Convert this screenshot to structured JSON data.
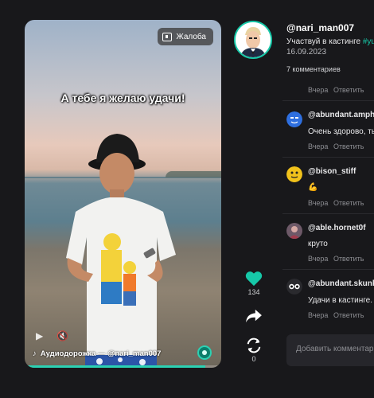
{
  "video": {
    "report_label": "Жалоба",
    "caption": "А тебе я желаю удачи!",
    "audio_track": "Аудиодорожка — @nari_man007",
    "progress_fraction": 0.92
  },
  "actions": {
    "likes": "134",
    "reposts": "0"
  },
  "post": {
    "author": "@nari_man007",
    "description_prefix": "Участвуй в кастинге ",
    "description_tag": "#yu",
    "date": "16.09.2023",
    "comments_count": "7 комментариев"
  },
  "comments": [
    {
      "author": "",
      "text": "",
      "time": "Вчера",
      "reply": "Ответить"
    },
    {
      "author": "@abundant.amphib",
      "text": "Очень здорово, ты",
      "time": "Вчера",
      "reply": "Ответить"
    },
    {
      "author": "@bison_stiff",
      "text": "💪",
      "time": "Вчера",
      "reply": "Ответить"
    },
    {
      "author": "@able.hornet0f",
      "text": "круто",
      "time": "Вчера",
      "reply": "Ответить"
    },
    {
      "author": "@abundant.skunkr",
      "text": "Удачи в кастинге.",
      "time": "Вчера",
      "reply": "Ответить"
    }
  ],
  "composer": {
    "placeholder": "Добавить комментари"
  },
  "colors": {
    "accent": "#16c8a8",
    "background": "#18181b"
  }
}
